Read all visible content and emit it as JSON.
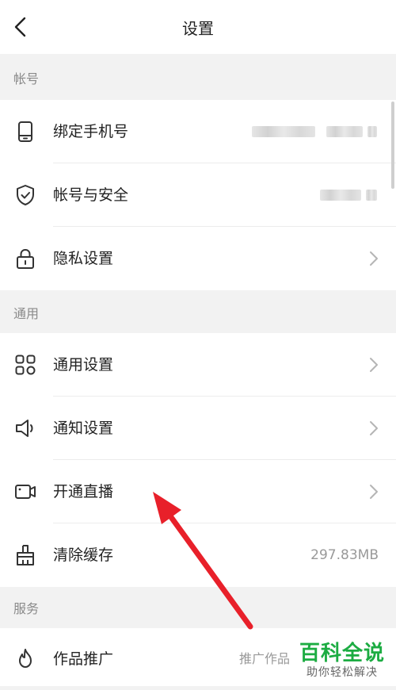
{
  "header": {
    "title": "设置",
    "back_icon": "chevron-left-icon"
  },
  "sections": {
    "account": "帐号",
    "general": "通用",
    "services": "服务"
  },
  "rows": {
    "bind_phone": {
      "label": "绑定手机号",
      "icon": "phone-icon"
    },
    "account_security": {
      "label": "帐号与安全",
      "icon": "shield-icon"
    },
    "privacy": {
      "label": "隐私设置",
      "icon": "lock-icon"
    },
    "general_settings": {
      "label": "通用设置",
      "icon": "grid-icon"
    },
    "notification": {
      "label": "通知设置",
      "icon": "speaker-icon"
    },
    "live": {
      "label": "开通直播",
      "icon": "camera-icon"
    },
    "clear_cache": {
      "label": "清除缓存",
      "icon": "broom-icon",
      "value": "297.83MB"
    },
    "promotion": {
      "label": "作品推广",
      "icon": "flame-icon",
      "value": "推广作品"
    }
  },
  "watermark": {
    "main": "百科全说",
    "sub": "助你轻松解决"
  },
  "colors": {
    "accent_arrow": "#e8202a",
    "watermark": "#1cac42"
  }
}
